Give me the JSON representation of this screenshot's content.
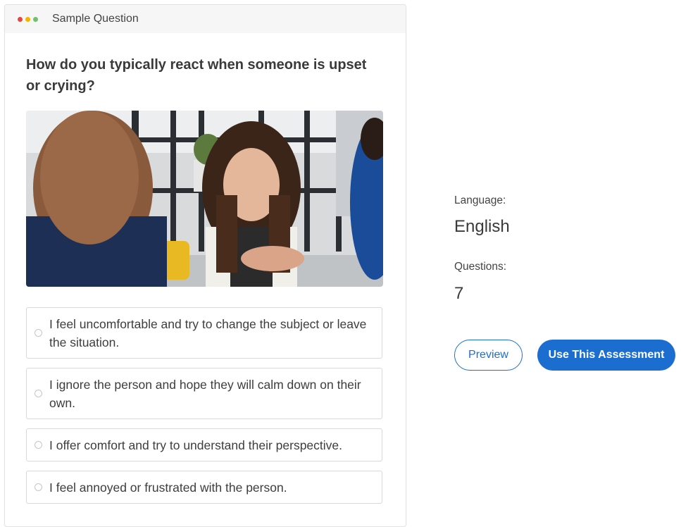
{
  "card": {
    "header_title": "Sample Question",
    "window_dots": [
      "#e8453c",
      "#f4b400",
      "#6cc36c"
    ],
    "question": "How do you typically react when someone is upset or crying?",
    "image_description_icon": "photo",
    "options": [
      "I feel uncomfortable and try to change the subject or leave the situation.",
      "I ignore the person and hope they will calm down on their own.",
      "I offer comfort and try to understand their perspective.",
      "I feel annoyed or frustrated with the person."
    ]
  },
  "details": {
    "language_label": "Language:",
    "language_value": "English",
    "questions_label": "Questions:",
    "questions_value": "7"
  },
  "actions": {
    "preview_label": "Preview",
    "use_label": "Use This Assessment"
  },
  "colors": {
    "accent": "#1c6dd0"
  }
}
